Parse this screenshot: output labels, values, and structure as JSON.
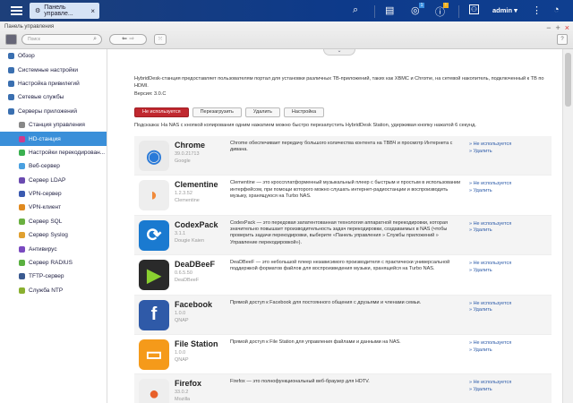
{
  "topbar": {
    "tab_label": "Панель управле...",
    "user": "admin ▾",
    "notif_badge": "1",
    "info_badge": "!"
  },
  "header": {
    "title": "Панель управления",
    "search_placeholder": "Поиск",
    "help": "?"
  },
  "sidebar": {
    "items": [
      {
        "label": "Обзор",
        "level": 1,
        "color": "#3a6fb0"
      },
      {
        "label": "Системные настройки",
        "level": 1,
        "color": "#3a6fb0"
      },
      {
        "label": "Настройка привилегий",
        "level": 1,
        "color": "#3a6fb0"
      },
      {
        "label": "Сетевые службы",
        "level": 1,
        "color": "#3a6fb0"
      },
      {
        "label": "Серверы приложений",
        "level": 1,
        "color": "#3a6fb0"
      },
      {
        "label": "Станция управления",
        "level": 2,
        "color": "#888"
      },
      {
        "label": "HD-станция",
        "level": 2,
        "color": "#d03a8c",
        "selected": true
      },
      {
        "label": "Настройки перекодирован...",
        "level": 2,
        "color": "#3ab050"
      },
      {
        "label": "Веб-сервер",
        "level": 2,
        "color": "#4aa0e0"
      },
      {
        "label": "Сервер LDAP",
        "level": 2,
        "color": "#6a4ab0"
      },
      {
        "label": "VPN-сервер",
        "level": 2,
        "color": "#3a5ab0"
      },
      {
        "label": "VPN-клиент",
        "level": 2,
        "color": "#e08a20"
      },
      {
        "label": "Сервер SQL",
        "level": 2,
        "color": "#6ab040"
      },
      {
        "label": "Сервер Syslog",
        "level": 2,
        "color": "#e0a030"
      },
      {
        "label": "Антивирус",
        "level": 2,
        "color": "#7a4ac0"
      },
      {
        "label": "Сервер RADIUS",
        "level": 2,
        "color": "#5ab040"
      },
      {
        "label": "TFTP-сервер",
        "level": 2,
        "color": "#3a5a90"
      },
      {
        "label": "Служба NTP",
        "level": 2,
        "color": "#8ab030"
      }
    ]
  },
  "main": {
    "intro": "HybridDesk-станция предоставляет пользователям портал для установки различных ТВ-приложений, таких как XBMC и Chrome, на сетевой накопитель, подключенный к ТВ по HDMI.",
    "version": "Версия: 3.0.C",
    "buttons": {
      "status": "Не используется",
      "restart": "Перезагрузить",
      "remove": "Удалить",
      "settings": "Настройка"
    },
    "hint": "Подсказка: На NAS с кнопкой копирования одним нажатием можно быстро перезапустить HybridDesk Station, удерживая кнопку нажатой 6 секунд.",
    "apps": [
      {
        "name": "Chrome",
        "version": "39.0.21713",
        "author": "Google",
        "desc": "Chrome обеспечивает передачу большого количества контента на ТВВЧ и просмотр Интернета с дивана.",
        "status": "» Не используется",
        "remove": "» Удалить",
        "icon": "chrome-icon",
        "color": "#eaeaea",
        "glyph": "◉",
        "glyph_color": "#2a7ad8"
      },
      {
        "name": "Clementine",
        "version": "1.2.3.52",
        "author": "Clementine",
        "desc": "Clementine — это кроссплатформенный музыкальный плеер с быстрым и простым в использовании интерфейсом, при помощи которого можно слушать интернет-радиостанции и воспроизводить музыку, хранящуюся на Turbo NAS.",
        "status": "» Не используется",
        "remove": "» Удалить",
        "icon": "clementine-icon",
        "color": "#eeeeee",
        "glyph": "◗",
        "glyph_color": "#f08a3a"
      },
      {
        "name": "CodexPack",
        "version": "3.1.1",
        "author": "Dougie Kaien",
        "desc": "CodexPack — это передовая запатентованная технология аппаратной перекодировки, которая значительно повышает производительность задач перекодировки, создаваемых в NAS (чтобы проверить задачи перекодировки, выберите «Панель управления » Службы приложений » Управление перекодировкой»).",
        "status": "» Не используется",
        "remove": "» Удалить",
        "icon": "codexpack-icon",
        "color": "#1a7ad0",
        "glyph": "⟳",
        "glyph_color": "#ffffff"
      },
      {
        "name": "DeaDBeeF",
        "version": "0.6.5.50",
        "author": "DeaDBeeF",
        "desc": "DeaDBeeF — это небольшой плеер независимого производителя с практически универсальной поддержкой форматов файлов для воспроизведения музыки, хранящейся на Turbo NAS.",
        "status": "» Не используется",
        "remove": "» Удалить",
        "icon": "deadbeef-icon",
        "color": "#2a2a2a",
        "glyph": "▶",
        "glyph_color": "#8ad030"
      },
      {
        "name": "Facebook",
        "version": "1.0.0",
        "author": "QNAP",
        "desc": "Прямой доступ к Facebook для постоянного общения с друзьями и членами семьи.",
        "status": "» Не используется",
        "remove": "» Удалить",
        "icon": "facebook-icon",
        "color": "#2f5aa8",
        "glyph": "f",
        "glyph_color": "#ffffff"
      },
      {
        "name": "File Station",
        "version": "1.0.0",
        "author": "QNAP",
        "desc": "Прямой доступ к File Station для управления файлами и данными на NAS.",
        "status": "» Не используется",
        "remove": "» Удалить",
        "icon": "folder-icon",
        "color": "#f59a1a",
        "glyph": "▭",
        "glyph_color": "#ffffff"
      },
      {
        "name": "Firefox",
        "version": "33.0.2",
        "author": "Mozilla",
        "desc": "Firefox — это полнофункциональный веб-браузер для HDTV.",
        "status": "» Не используется",
        "remove": "» Удалить",
        "icon": "firefox-icon",
        "color": "#eeeeee",
        "glyph": "●",
        "glyph_color": "#e8602a"
      }
    ]
  }
}
